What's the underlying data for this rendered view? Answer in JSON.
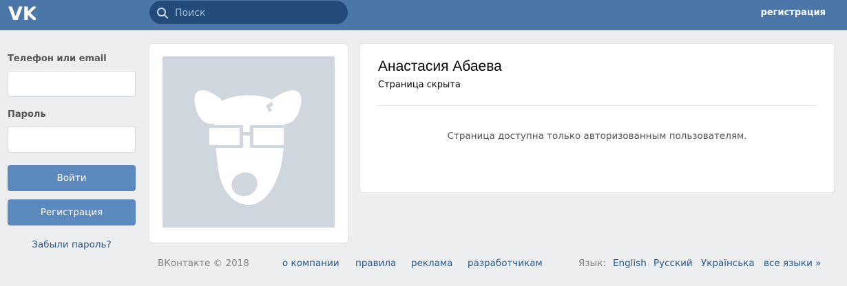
{
  "header": {
    "logo_text": "VK",
    "search_placeholder": "Поиск",
    "register_link": "регистрация"
  },
  "login": {
    "phone_label": "Телефон или email",
    "phone_value": "",
    "password_label": "Пароль",
    "password_value": "",
    "login_button": "Войти",
    "register_button": "Регистрация",
    "forgot_link": "Забыли пароль?"
  },
  "profile": {
    "name": "Анастасия Абаева",
    "status": "Страница скрыта",
    "notice": "Страница доступна только авторизованным пользователям."
  },
  "footer": {
    "copyright": "ВКонтакте © 2018",
    "links": [
      "о компании",
      "правила",
      "реклама",
      "разработчикам"
    ],
    "language_label": "Язык:",
    "languages": [
      "English",
      "Русский",
      "Українська",
      "все языки »"
    ]
  },
  "colors": {
    "header": "#4a76a8",
    "search_bg": "#224b7a",
    "button": "#5b88bd",
    "link": "#2a5885",
    "page_bg": "#edeef0",
    "avatar_bg": "#d0d6de"
  }
}
